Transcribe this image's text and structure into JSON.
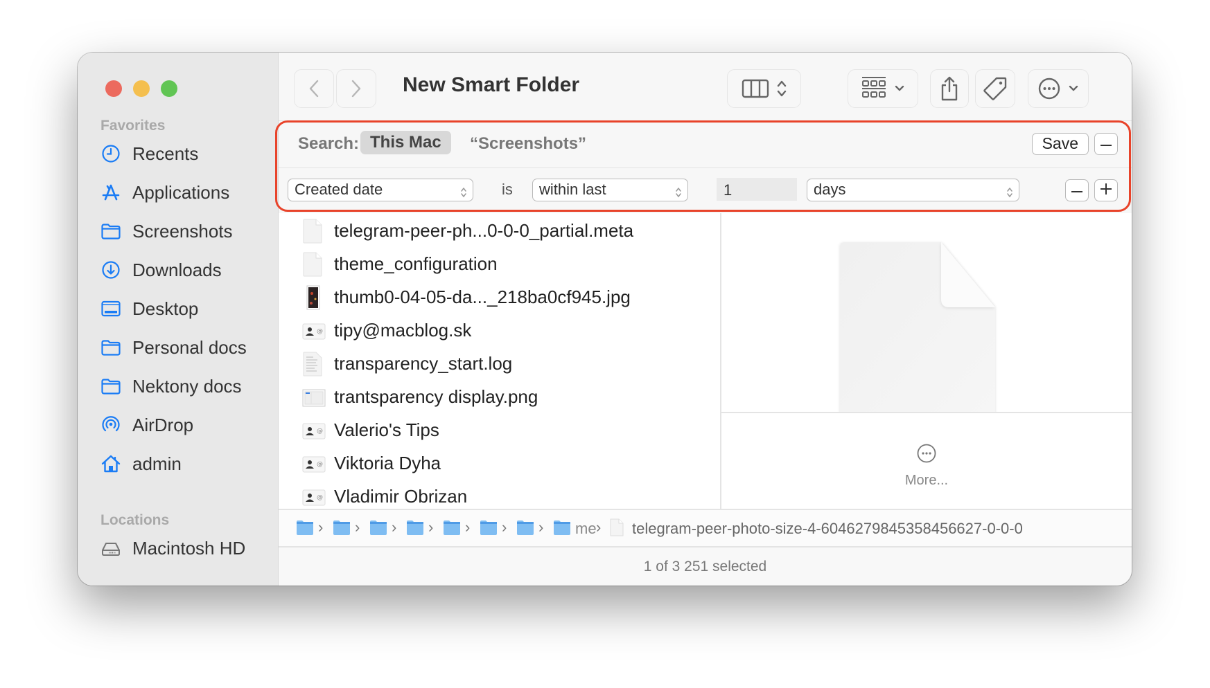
{
  "window": {
    "title": "New Smart Folder",
    "traffic_lights": [
      "close",
      "minimize",
      "zoom"
    ]
  },
  "sidebar": {
    "sections": [
      {
        "label": "Favorites",
        "items": [
          {
            "label": "Recents",
            "icon": "clock-icon"
          },
          {
            "label": "Applications",
            "icon": "applications-icon"
          },
          {
            "label": "Screenshots",
            "icon": "folder-icon"
          },
          {
            "label": "Downloads",
            "icon": "download-icon"
          },
          {
            "label": "Desktop",
            "icon": "desktop-icon"
          },
          {
            "label": "Personal docs",
            "icon": "folder-icon"
          },
          {
            "label": "Nektony docs",
            "icon": "folder-icon"
          },
          {
            "label": "AirDrop",
            "icon": "airdrop-icon"
          },
          {
            "label": "admin",
            "icon": "home-icon"
          }
        ]
      },
      {
        "label": "Locations",
        "items": [
          {
            "label": "Macintosh HD",
            "icon": "hard-drive-icon"
          }
        ]
      }
    ]
  },
  "toolbar": {
    "back_icon": "chevron-left-icon",
    "forward_icon": "chevron-right-icon",
    "view_icon": "column-view-icon",
    "group_icon": "grid-group-icon",
    "share_icon": "share-icon",
    "tag_icon": "tag-icon",
    "action_icon": "ellipsis-circle-icon",
    "search_icon": "search-icon"
  },
  "search": {
    "label": "Search:",
    "scopes": [
      {
        "label": "This Mac",
        "selected": true
      },
      {
        "label": "“Screenshots”",
        "selected": false
      }
    ],
    "save_label": "Save",
    "criteria": {
      "attribute": "Created date",
      "operator_label": "is",
      "condition": "within last",
      "value": "1",
      "unit": "days"
    },
    "highlight_color": "#e8432a"
  },
  "files": [
    {
      "name": "telegram-peer-ph...0-0-0_partial.meta",
      "icon": "document-icon"
    },
    {
      "name": "theme_configuration",
      "icon": "document-icon"
    },
    {
      "name": "thumb0-04-05-da..._218ba0cf945.jpg",
      "icon": "image-thumbnail-icon"
    },
    {
      "name": "tipy@macblog.sk",
      "icon": "contact-card-icon"
    },
    {
      "name": "transparency_start.log",
      "icon": "log-file-icon"
    },
    {
      "name": "trantsparency display.png",
      "icon": "screenshot-thumbnail-icon"
    },
    {
      "name": "Valerio's Tips",
      "icon": "contact-card-icon"
    },
    {
      "name": "Viktoria Dyha",
      "icon": "contact-card-icon"
    },
    {
      "name": "Vladimir Obrizan",
      "icon": "contact-card-icon"
    }
  ],
  "preview": {
    "icon": "blank-document-icon",
    "more_label": "More..."
  },
  "pathbar": {
    "folder_count": 8,
    "truncated_label": "me",
    "file_name": "telegram-peer-photo-size-4-6046279845358456627-0-0-0"
  },
  "status": {
    "text": "1 of 3 251 selected"
  },
  "colors": {
    "accent": "#1a7cf5",
    "folder_blue": "#7fbdf2"
  }
}
